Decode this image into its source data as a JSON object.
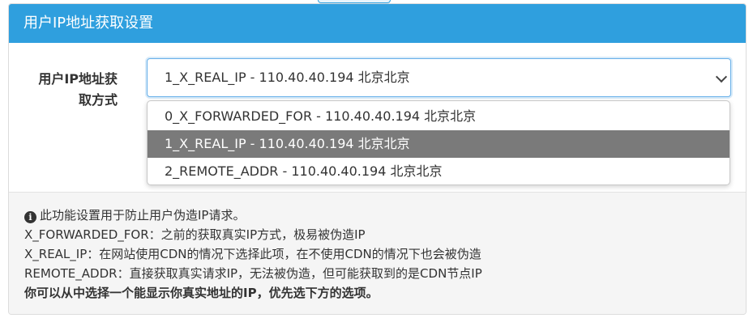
{
  "panel": {
    "title": "用户IP地址获取设置"
  },
  "form": {
    "label_line1": "用户IP地址获",
    "label_line2": "取方式",
    "selected_value": "1_X_REAL_IP - 110.40.40.194 北京北京",
    "options": [
      "0_X_FORWARDED_FOR - 110.40.40.194 北京北京",
      "1_X_REAL_IP - 110.40.40.194 北京北京",
      "2_REMOTE_ADDR - 110.40.40.194 北京北京"
    ],
    "selected_index": 1
  },
  "help": {
    "intro": "此功能设置用于防止用户伪造IP请求。",
    "line_forwarded": "X_FORWARDED_FOR：之前的获取真实IP方式，极易被伪造IP",
    "line_real_ip": "X_REAL_IP：在网站使用CDN的情况下选择此项，在不使用CDN的情况下也会被伪造",
    "line_remote": "REMOTE_ADDR：直接获取真实请求IP，无法被伪造，但可能获取到的是CDN节点IP",
    "line_tip": "你可以从中选择一个能显示你真实地址的IP，优先选下方的选项。"
  },
  "icons": {
    "info": "info-circle-icon",
    "chevron": "chevron-down-icon"
  },
  "colors": {
    "header_bg": "#2f9fde",
    "selected_option_bg": "#7a7a7a",
    "help_bg": "#f5f5f5"
  }
}
